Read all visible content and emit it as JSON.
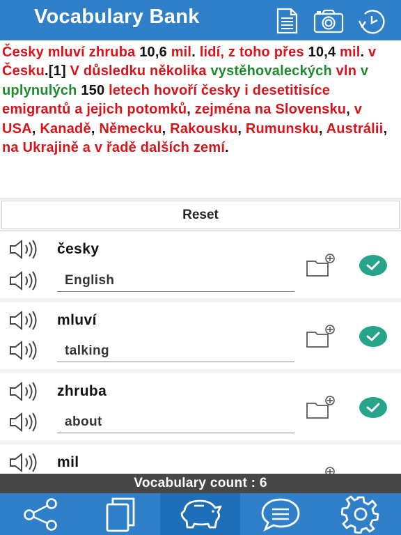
{
  "header": {
    "title": "Vocabulary Bank",
    "buttons": [
      {
        "name": "document-icon"
      },
      {
        "name": "camera-icon"
      },
      {
        "name": "history-icon"
      }
    ]
  },
  "passage": {
    "segments": [
      {
        "text": "Česky mluví zhruba ",
        "color": "red"
      },
      {
        "text": "10,6 ",
        "color": "black"
      },
      {
        "text": "mil",
        "color": "red"
      },
      {
        "text": ". ",
        "color": "black"
      },
      {
        "text": "lidí, z toho přes",
        "color": "red"
      },
      {
        "text": " 10,4 ",
        "color": "black"
      },
      {
        "text": "mil",
        "color": "red"
      },
      {
        "text": ". ",
        "color": "black"
      },
      {
        "text": "v Česku",
        "color": "red"
      },
      {
        "text": ".[1] ",
        "color": "black"
      },
      {
        "text": "V důsledku několika",
        "color": "red"
      },
      {
        "text": " ",
        "color": "black"
      },
      {
        "text": "vystěhovaleckých",
        "color": "green"
      },
      {
        "text": " vln ",
        "color": "red"
      },
      {
        "text": "v uplynulých",
        "color": "green"
      },
      {
        "text": " 150 ",
        "color": "black"
      },
      {
        "text": "letech hovoří česky i desetitisíce emigrantů a jejich potomků",
        "color": "red"
      },
      {
        "text": ", ",
        "color": "black"
      },
      {
        "text": "zejména na Slovensku",
        "color": "red"
      },
      {
        "text": ", ",
        "color": "black"
      },
      {
        "text": "v USA",
        "color": "red"
      },
      {
        "text": ", ",
        "color": "black"
      },
      {
        "text": "Kanadě",
        "color": "red"
      },
      {
        "text": ", ",
        "color": "black"
      },
      {
        "text": "Německu",
        "color": "red"
      },
      {
        "text": ", ",
        "color": "black"
      },
      {
        "text": "Rakousku",
        "color": "red"
      },
      {
        "text": ", ",
        "color": "black"
      },
      {
        "text": "Rumunsku",
        "color": "red"
      },
      {
        "text": ", ",
        "color": "black"
      },
      {
        "text": "Austrálii",
        "color": "red"
      },
      {
        "text": ", ",
        "color": "black"
      },
      {
        "text": "na Ukrajině a v řadě dalších zemí",
        "color": "red"
      },
      {
        "text": ".",
        "color": "black"
      }
    ]
  },
  "reset": {
    "label": "Reset"
  },
  "vocab": [
    {
      "word": "česky",
      "translation": "English"
    },
    {
      "word": "mluví",
      "translation": "talking"
    },
    {
      "word": "zhruba",
      "translation": "about"
    },
    {
      "word": "mil",
      "translation": ""
    }
  ],
  "footer": {
    "count_text": "Vocabulary count : 6"
  },
  "tabs": [
    {
      "name": "share",
      "label": "share-icon",
      "active": false
    },
    {
      "name": "pages",
      "label": "pages-icon",
      "active": false
    },
    {
      "name": "vocabulary",
      "label": "piggy-bank-icon",
      "active": true
    },
    {
      "name": "messages",
      "label": "chat-icon",
      "active": false
    },
    {
      "name": "settings",
      "label": "gear-icon",
      "active": false
    }
  ],
  "colors": {
    "header_blue": "#2f80c8",
    "red_text": "#d8141b",
    "green_text": "#1e8a2e",
    "check_teal": "#27a58b",
    "count_bar": "#474747"
  }
}
